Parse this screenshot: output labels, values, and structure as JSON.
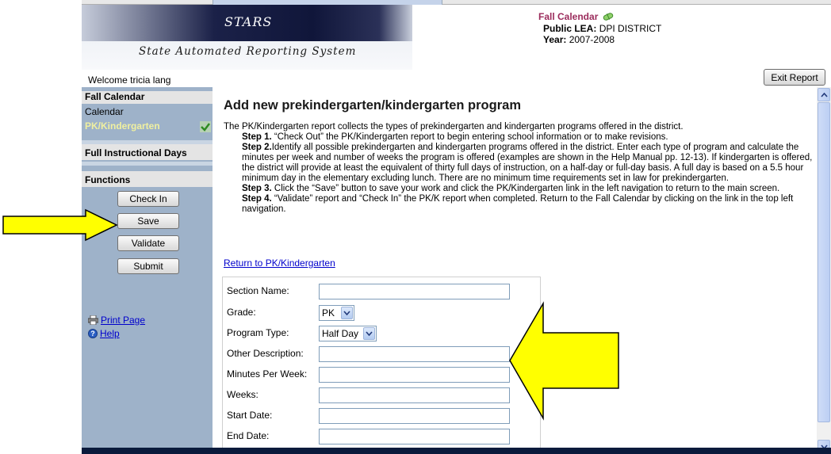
{
  "header": {
    "logo_title": "STARS",
    "logo_subtitle": "State Automated Reporting System",
    "report_title": "Fall Calendar",
    "lea_label": "Public LEA:",
    "lea_value": "DPI DISTRICT",
    "year_label": "Year:",
    "year_value": "2007-2008",
    "welcome": "Welcome tricia lang",
    "exit_label": "Exit Report"
  },
  "sidebar": {
    "section1_title": "Fall Calendar",
    "item_calendar": "Calendar",
    "item_pk": "PK/Kindergarten",
    "section2_title": "Full Instructional Days",
    "functions_title": "Functions",
    "btn_check_in": "Check In",
    "btn_save": "Save",
    "btn_validate": "Validate",
    "btn_submit": "Submit",
    "print_page": "Print Page",
    "help": "Help"
  },
  "main": {
    "title": "Add new prekindergarten/kindergarten program",
    "intro": "The PK/Kindergarten report collects the types of prekindergarten and kindergarten programs offered in the district.",
    "step1_label": "Step 1.",
    "step1_text": " “Check Out” the PK/Kindergarten report to begin entering school information or to make revisions.",
    "step2_label": "Step 2.",
    "step2_text": "Identify all possible prekindergarten and kindergarten programs offered in the district. Enter each type of program and calculate the minutes per week and number of weeks the program is offered (examples are shown in the Help Manual pp. 12-13). If kindergarten is offered, the district will provide at least the equivalent of thirty full days of instruction, on a half-day or full-day basis. A full day is based on a 5.5 hour minimum day in the elementary excluding lunch. There are no minimum time requirements set in law for prekindergarten.",
    "step3_label": "Step 3.",
    "step3_text": " Click the “Save” button to save your work and click the PK/Kindergarten link in the left navigation to return to the main screen.",
    "step4_label": "Step 4.",
    "step4_text": " “Validate” report and “Check In” the PK/K report when completed. Return to the Fall Calendar by clicking on the link in the top left navigation.",
    "return_link": "Return to PK/Kindergarten"
  },
  "form": {
    "section_name_label": "Section Name:",
    "section_name_value": "",
    "grade_label": "Grade:",
    "grade_value": "PK",
    "program_type_label": "Program Type:",
    "program_type_value": "Half Day",
    "other_description_label": "Other Description:",
    "other_description_value": "",
    "minutes_label": "Minutes Per Week:",
    "minutes_value": "",
    "weeks_label": "Weeks:",
    "weeks_value": "",
    "start_date_label": "Start Date:",
    "start_date_value": "",
    "end_date_label": "End Date:",
    "end_date_value": ""
  },
  "annotations": {
    "arrow_color": "#ffff00",
    "arrow_outline": "#000000"
  }
}
